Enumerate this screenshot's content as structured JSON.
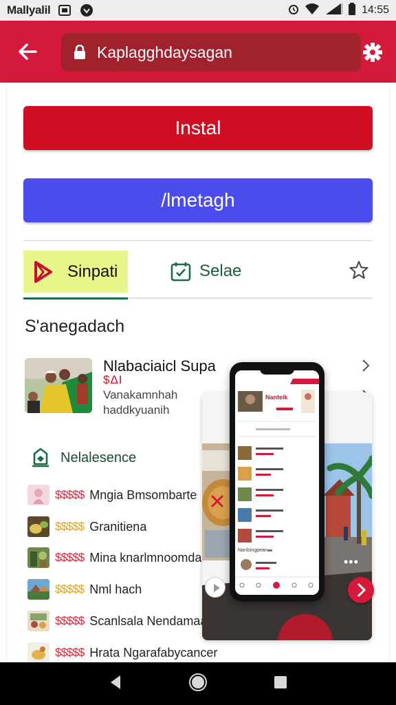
{
  "status_bar": {
    "carrier": "Mallyalil",
    "time": "14:55"
  },
  "app_bar": {
    "url": "Kaplagghdaysagan"
  },
  "actions": {
    "install_label": "Instal",
    "second_label": "/lmetagh"
  },
  "tabs": [
    {
      "label": "Sinpati"
    },
    {
      "label": "Selae"
    }
  ],
  "section_title": "S'anegadach",
  "featured": {
    "title": "Nlabaciaicl Supa",
    "price": "$ΔI",
    "line1": "Vanakamnhah",
    "line2": "haddkyuanih"
  },
  "recommend_heading": "Nelalesence",
  "list": [
    {
      "rating": "$$$$$",
      "label": "Mngia Bmsombarte",
      "rating_color": "#d9263d"
    },
    {
      "rating": "$$$$$",
      "label": "Granitiena",
      "rating_color": "#e3a21a"
    },
    {
      "rating": "$$$$$",
      "label": "Mina knarlmnoomdak",
      "rating_color": "#d9263d"
    },
    {
      "rating": "$$$$$",
      "label": "Nml hach",
      "rating_color": "#e3a21a"
    },
    {
      "rating": "$$$$$",
      "label": "Scanlsala Nendamaam",
      "rating_color": "#d9263d"
    },
    {
      "rating": "$$$$$",
      "label": "Hrata Ngarafabycancer",
      "rating_color": "#d9263d"
    }
  ],
  "promo": {
    "phone_header": "Nanteik",
    "phone_section": "Nanlsingpean"
  },
  "colors": {
    "brand_red": "#d5193a",
    "install_red": "#cf0f23",
    "accent_blue": "#4a4cee",
    "tab_highlight": "#e7f58a",
    "accent_green": "#1b6b46"
  },
  "icons": {
    "back": "arrow-left-icon",
    "lock": "lock-icon",
    "settings": "gear-icon",
    "star": "star-outline-icon",
    "close": "close-icon",
    "next": "chevron-right-icon"
  }
}
